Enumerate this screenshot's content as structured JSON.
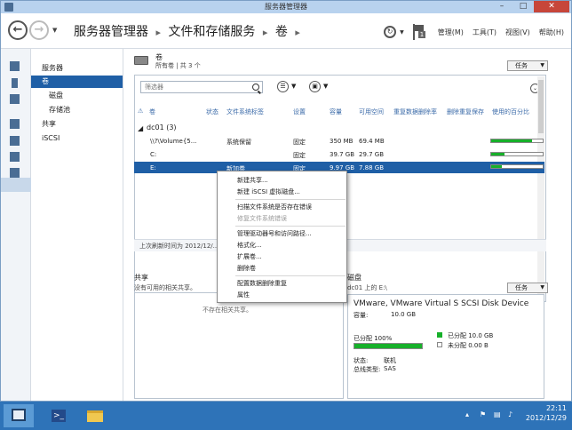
{
  "window": {
    "title": "服务器管理器"
  },
  "header": {
    "breadcrumb": [
      "服务器管理器",
      "文件和存储服务",
      "卷"
    ],
    "badge_count": "1",
    "menus": [
      "管理(M)",
      "工具(T)",
      "视图(V)",
      "帮助(H)"
    ]
  },
  "sidebar": {
    "items": [
      {
        "label": "服务器",
        "level": 0,
        "active": false
      },
      {
        "label": "卷",
        "level": 0,
        "active": true
      },
      {
        "label": "磁盘",
        "level": 1,
        "active": false
      },
      {
        "label": "存储池",
        "level": 1,
        "active": false
      },
      {
        "label": "共享",
        "level": 0,
        "active": false
      },
      {
        "label": "iSCSI",
        "level": 0,
        "active": false
      }
    ]
  },
  "volumes": {
    "title": "卷",
    "subtitle": "所有卷 | 共 3 个",
    "tasks_label": "任务",
    "filter_placeholder": "筛选器",
    "columns": [
      "卷",
      "状态",
      "文件系统标签",
      "设置",
      "容量",
      "可用空间",
      "重复数据删除率",
      "删除重复保存",
      "使用的百分比"
    ],
    "group": "dc01 (3)",
    "rows": [
      {
        "volume": "\\\\?\\Volume{5...",
        "status": "",
        "label": "系统保留",
        "setting": "固定",
        "capacity": "350 MB",
        "free": "69.4 MB",
        "used_pct": 80,
        "selected": false
      },
      {
        "volume": "C:",
        "status": "",
        "label": "",
        "setting": "固定",
        "capacity": "39.7 GB",
        "free": "29.7 GB",
        "used_pct": 25,
        "selected": false
      },
      {
        "volume": "E:",
        "status": "",
        "label": "新加卷",
        "setting": "固定",
        "capacity": "9.97 GB",
        "free": "7.88 GB",
        "used_pct": 21,
        "selected": true
      }
    ],
    "last_refresh": "上次刷新时间为 2012/12/..."
  },
  "context_menu": {
    "items": [
      {
        "label": "新建共享...",
        "disabled": false
      },
      {
        "label": "新建 iSCSI 虚拟磁盘...",
        "disabled": false
      },
      {
        "label": "扫描文件系统是否存在错误",
        "disabled": false
      },
      {
        "label": "修复文件系统错误",
        "disabled": true
      },
      {
        "label": "管理驱动器号和访问路径...",
        "disabled": false
      },
      {
        "label": "格式化...",
        "disabled": false
      },
      {
        "label": "扩展卷...",
        "disabled": false
      },
      {
        "label": "删除卷",
        "disabled": false
      },
      {
        "label": "配置数据删除重复",
        "disabled": false
      },
      {
        "label": "属性",
        "disabled": false
      }
    ]
  },
  "shares": {
    "title": "共享",
    "subtitle": "没有可用的相关共享。",
    "empty_text": "不存在相关共享。"
  },
  "disk": {
    "title": "磁盘",
    "subtitle": "dc01 上的 E:\\",
    "tasks_label": "任务",
    "name": "VMware, VMware Virtual S SCSI Disk Device",
    "capacity_label": "容量:",
    "capacity_value": "10.0 GB",
    "allocated_label": "已分配 100%",
    "allocated_pct": 100,
    "legend_allocated": "已分配 10.0 GB",
    "legend_unallocated": "未分配 0.00 B",
    "status_label": "状态:",
    "status_value": "联机",
    "bus_label": "总线类型:",
    "bus_value": "SAS"
  },
  "taskbar": {
    "time": "22:11",
    "date": "2012/12/29"
  }
}
